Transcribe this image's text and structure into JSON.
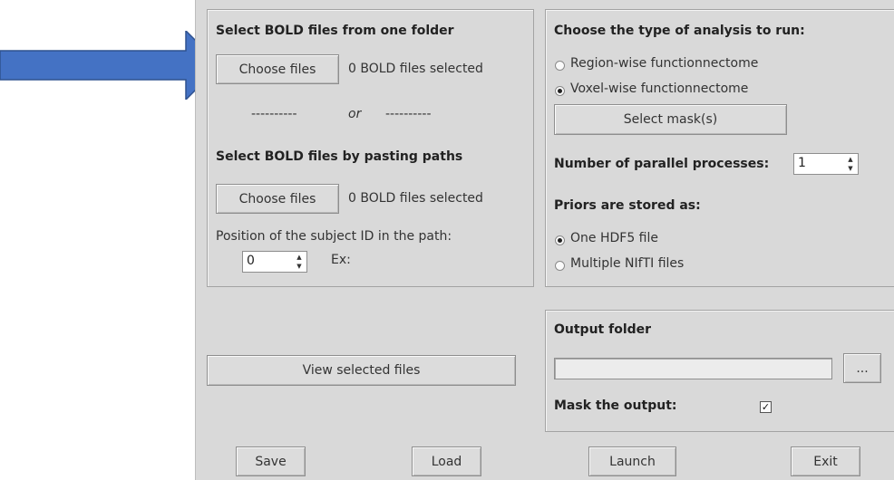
{
  "left_panel": {
    "folder_title": "Select BOLD files from one folder",
    "choose_files_label": "Choose files",
    "folder_count_text": "0 BOLD files selected",
    "separator_left": "----------",
    "separator_or": "or",
    "separator_right": "----------",
    "paths_title": "Select BOLD files by pasting paths",
    "paths_choose_label": "Choose files",
    "paths_count_text": "0 BOLD files selected",
    "position_label": "Position of the subject ID in the path:",
    "position_value": "0",
    "example_label": "Ex:"
  },
  "view_selected_label": "View selected files",
  "analysis_panel": {
    "title": "Choose the type of analysis to run:",
    "options": [
      "Region-wise functionnectome",
      "Voxel-wise functionnectome"
    ],
    "selected_option": "Voxel-wise functionnectome",
    "select_mask_label": "Select mask(s)",
    "parallel_label": "Number of parallel processes:",
    "parallel_value": "1",
    "priors_title": "Priors are stored as:",
    "priors_options": [
      "One HDF5 file",
      "Multiple NIfTI files"
    ],
    "priors_selected": "One HDF5 file"
  },
  "output_panel": {
    "title": "Output folder",
    "path_value": "",
    "browse_label": "...",
    "mask_label": "Mask the output:",
    "mask_checked": true,
    "check_glyph": "✓"
  },
  "bottom_buttons": {
    "save": "Save",
    "load": "Load",
    "launch": "Launch",
    "exit": "Exit"
  },
  "annotation": {
    "arrow_color": "#4472c4"
  }
}
